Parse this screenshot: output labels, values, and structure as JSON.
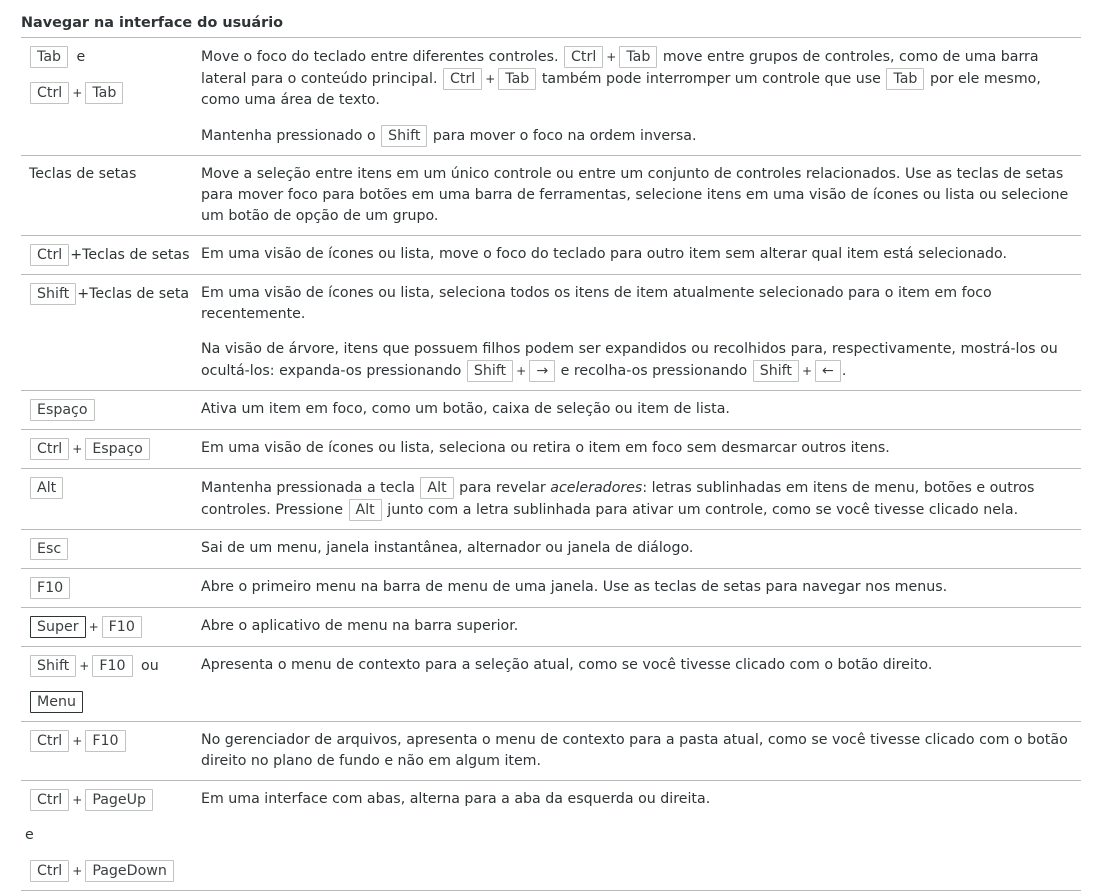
{
  "section_title": "Navegar na interface do usuário",
  "common": {
    "ctrl": "Ctrl",
    "tab": "Tab",
    "shift": "Shift",
    "alt": "Alt",
    "plus": "+",
    "e": "e",
    "ou": "ou"
  },
  "rows": {
    "r1": {
      "keys_super": "Super",
      "p1": {
        "a": "Move o foco do teclado entre diferentes controles.",
        "b": "move entre grupos de controles, como de uma barra lateral para o conteúdo principal.",
        "c": "também pode interromper um controle que use",
        "d": "por ele mesmo, como uma área de texto."
      },
      "p2": {
        "a": "Mantenha pressionado o",
        "b": "para mover o foco na ordem inversa."
      }
    },
    "r2": {
      "keys_text": "Teclas de setas",
      "desc": "Move a seleção entre itens em um único controle ou entre um conjunto de controles relacionados. Use as teclas de setas para mover foco para botões em uma barra de ferramentas, selecione itens em uma visão de ícones ou lista ou selecione um botão de opção de um grupo."
    },
    "r3": {
      "keys_suffix": "+Teclas de setas",
      "desc": "Em uma visão de ícones ou lista, move o foco do teclado para outro item sem alterar qual item está selecionado."
    },
    "r4": {
      "keys_suffix": "+Teclas de seta",
      "p1": "Em uma visão de ícones ou lista, seleciona todos os itens de item atualmente selecionado para o item em foco recentemente.",
      "p2": {
        "a": "Na visão de árvore, itens que possuem filhos podem ser expandidos ou recolhidos para, respectivamente, mostrá-los ou ocultá-los: expanda-os pressionando",
        "right_arrow": "→",
        "b": "e recolha-os pressionando",
        "left_arrow": "←",
        "c": "."
      }
    },
    "r5": {
      "key": "Espaço",
      "desc": "Ativa um item em foco, como um botão, caixa de seleção ou item de lista."
    },
    "r6": {
      "key": "Espaço",
      "desc": "Em uma visão de ícones ou lista, seleciona ou retira o item em foco sem desmarcar outros itens."
    },
    "r7": {
      "a": "Mantenha pressionada a tecla",
      "b": "para revelar",
      "em": "aceleradores",
      "c": ": letras sublinhadas em itens de menu, botões e outros controles. Pressione",
      "d": "junto com a letra sublinhada para ativar um controle, como se você tivesse clicado nela."
    },
    "r8": {
      "key": "Esc",
      "desc": "Sai de um menu, janela instantânea, alternador ou janela de diálogo."
    },
    "r9": {
      "key": "F10",
      "desc": "Abre o primeiro menu na barra de menu de uma janela. Use as teclas de setas para navegar nos menus."
    },
    "r10": {
      "key1": "Super",
      "key2": "F10",
      "desc": "Abre o aplicativo de menu na barra superior."
    },
    "r11": {
      "key2": "F10",
      "key3": "Menu",
      "desc": "Apresenta o menu de contexto para a seleção atual, como se você tivesse clicado com o botão direito."
    },
    "r12": {
      "key2": "F10",
      "desc": "No gerenciador de arquivos, apresenta o menu de contexto para a pasta atual, como se você tivesse clicado com o botão direito no plano de fundo e não em algum item."
    },
    "r13": {
      "key1": "PageUp",
      "key2": "PageDown",
      "desc": "Em uma interface com abas, alterna para a aba da esquerda ou direita."
    }
  }
}
